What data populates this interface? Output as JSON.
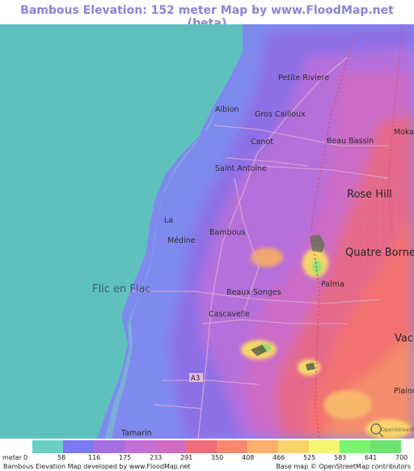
{
  "title": "Bambous Elevation: 152 meter Map by www.FloodMap.net (beta)",
  "colors": {
    "sea": "#5ec1be",
    "title": "#8a83d8"
  },
  "places": [
    {
      "name": "Petite Riviere"
    },
    {
      "name": "Albion"
    },
    {
      "name": "Gros Cailloux"
    },
    {
      "name": "Moka"
    },
    {
      "name": "Canot"
    },
    {
      "name": "Beau Bassin"
    },
    {
      "name": "Saint Antoine"
    },
    {
      "name": "Rose Hill"
    },
    {
      "name": "La"
    },
    {
      "name": "Bambous"
    },
    {
      "name": "Médine"
    },
    {
      "name": "Quatre Bornes"
    },
    {
      "name": "Flic en Flac"
    },
    {
      "name": "Beaux Songes"
    },
    {
      "name": "Palma"
    },
    {
      "name": "Cascavelle"
    },
    {
      "name": "Vaco"
    },
    {
      "name": "Plaine"
    },
    {
      "name": "Tamarin"
    }
  ],
  "road_label": "A3",
  "osm_watermark": "OpenStreetMap",
  "legend": {
    "unit": "meter",
    "ticks": [
      "0",
      "58",
      "116",
      "175",
      "233",
      "291",
      "350",
      "408",
      "466",
      "525",
      "583",
      "641",
      "700"
    ],
    "colors": [
      "#6ccfc4",
      "#7b7bf0",
      "#a570e0",
      "#c36fd6",
      "#cf6bc3",
      "#ef6d78",
      "#f8896f",
      "#fbb06d",
      "#f8d36c",
      "#f4f570",
      "#7cf46f",
      "#6ee36f"
    ]
  },
  "footer": {
    "left": "Bambous Elevation Map developed by www.FloodMap.net",
    "right": "Base map © OpenStreetMap contributors"
  }
}
